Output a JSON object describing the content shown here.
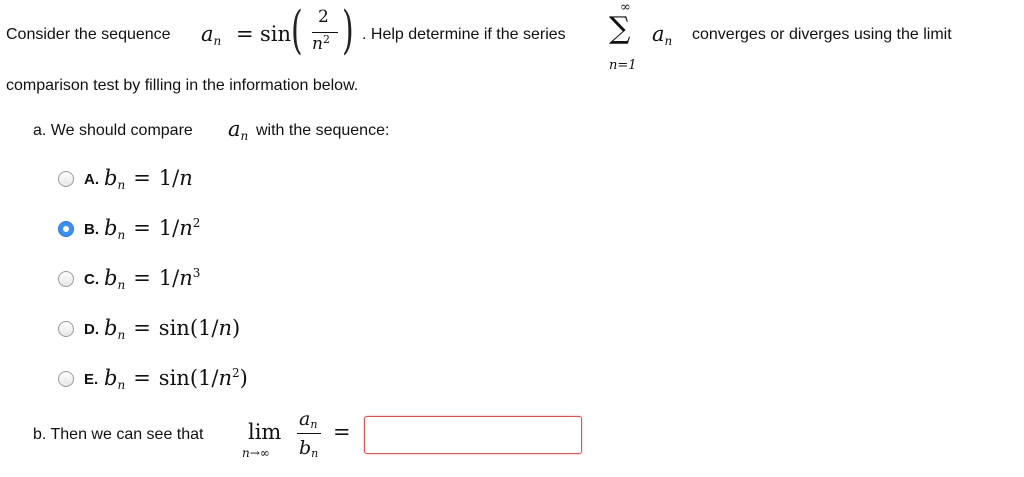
{
  "question": {
    "intro_prefix": "Consider the sequence",
    "a_sym": "a",
    "n_sub": "n",
    "eq": "=",
    "sin": "sin",
    "num_two": "2",
    "den_n": "n",
    "den_exp": "2",
    "help_text": ". Help determine if the series",
    "sigma": "∑",
    "sum_upper": "∞",
    "sum_lower": "n=1",
    "series_term": "a",
    "series_sub": "n",
    "tail_text": "converges or diverges using the limit",
    "line2": "comparison test by filling in the information below."
  },
  "part_a": {
    "label": "a. We should compare",
    "a_sym": "a",
    "a_sub": "n",
    "label_tail": "with the sequence:",
    "selected": "B",
    "options": [
      {
        "letter": "A.",
        "b": "b",
        "sub": "n",
        "eq": "=",
        "expr": "1/",
        "var": "n",
        "exp": "",
        "close": ""
      },
      {
        "letter": "B.",
        "b": "b",
        "sub": "n",
        "eq": "=",
        "expr": "1/",
        "var": "n",
        "exp": "2",
        "close": ""
      },
      {
        "letter": "C.",
        "b": "b",
        "sub": "n",
        "eq": "=",
        "expr": "1/",
        "var": "n",
        "exp": "3",
        "close": ""
      },
      {
        "letter": "D.",
        "b": "b",
        "sub": "n",
        "eq": "=",
        "expr": "sin(1/",
        "var": "n",
        "exp": "",
        "close": ")"
      },
      {
        "letter": "E.",
        "b": "b",
        "sub": "n",
        "eq": "=",
        "expr": "sin(1/",
        "var": "n",
        "exp": "2",
        "close": ")"
      }
    ]
  },
  "part_b": {
    "label": "b. Then we can see that",
    "lim": "lim",
    "lim_sub": "n→∞",
    "num_a": "a",
    "num_sub": "n",
    "den_b": "b",
    "den_sub": "n",
    "eq": "=",
    "answer_value": ""
  },
  "colors": {
    "radio_selected": "#3d8ff2",
    "answer_border": "#d9534f"
  }
}
